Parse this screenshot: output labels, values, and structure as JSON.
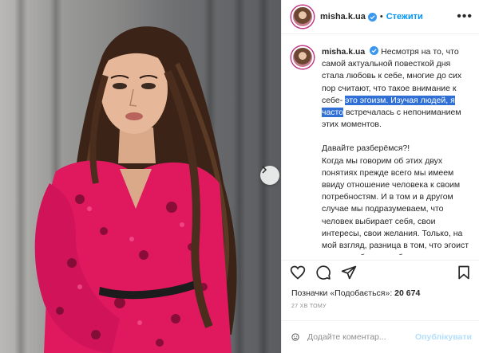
{
  "post": {
    "username": "misha.k.ua",
    "follow_label": "Стежити",
    "more_label": "•••",
    "separator": "•"
  },
  "caption": {
    "username": "misha.k.ua",
    "p1_start": "Несмотря на то, что самой актуальной повесткой дня стала любовь к себе, многие до сих пор считают, что такое внимание к себе- ",
    "p1_highlight": "это эгоизм. Изучая людей, я часто",
    "p1_end": " встречалась с непониманием этих моментов.",
    "p2": "Давайте разберёмся?!",
    "p3": "Когда мы говорим об этих двух понятиях прежде всего мы имеем ввиду отношение человека к своим потребностям. И в том и в другом случае мы подразумеваем, что человек выбирает себя, свои интересы, свои желания. Только, на мой взгляд, разница в том, что эгоист всегда выбирает себя и не меняет свою позицию, даже если причиняет"
  },
  "likes": {
    "label": "Позначки «Подобається»: ",
    "count": "20 674"
  },
  "timestamp": "27 хв тому",
  "comment": {
    "placeholder": "Додайте коментар...",
    "publish_label": "Опублікувати"
  },
  "colors": {
    "accent": "#0095f6",
    "highlight": "#2f6fd6",
    "dress": "#e0195f"
  },
  "icons": [
    "verified-badge-icon",
    "more-options-icon",
    "heart-icon",
    "comment-icon",
    "share-icon",
    "bookmark-icon",
    "emoji-icon",
    "next-arrow-icon"
  ]
}
